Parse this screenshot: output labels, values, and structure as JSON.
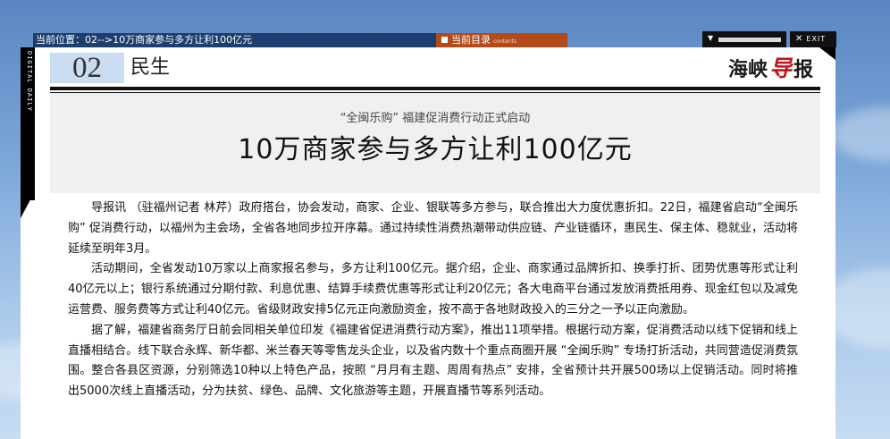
{
  "nav": {
    "location": "当前位置：02-->10万商家参与多方让利100亿元",
    "catalog_label": "当前目录",
    "catalog_sub": "contents",
    "exit_label": "EXIT"
  },
  "spine": {
    "text": "DIGITAL DAILY"
  },
  "header": {
    "page_number": "02",
    "section": "民生",
    "logo_prefix": "海峡",
    "logo_highlight": "导",
    "logo_suffix": "报"
  },
  "article": {
    "kicker": "“全闽乐购” 福建促消费行动正式启动",
    "headline": "10万商家参与多方让利100亿元",
    "paragraphs": [
      "导报讯 （驻福州记者 林芹）政府搭台，协会发动，商家、企业、银联等多方参与，联合推出大力度优惠折扣。22日，福建省启动“全闽乐购” 促消费行动，以福州为主会场，全省各地同步拉开序幕。通过持续性消费热潮带动供应链、产业链循环，惠民生、保主体、稳就业，活动将延续至明年3月。",
      "活动期间，全省发动10万家以上商家报名参与，多方让利100亿元。据介绍，企业、商家通过品牌折扣、换季打折、团势优惠等形式让利40亿元以上；银行系统通过分期付款、利息优惠、结算手续费优惠等形式让利20亿元；各大电商平台通过发放消费抵用券、现金红包以及减免运营费、服务费等方式让利40亿元。省级财政安排5亿元正向激励资金，按不高于各地财政投入的三分之一予以正向激励。",
      "据了解，福建省商务厅日前会同相关单位印发《福建省促进消费行动方案》，推出11项举措。根据行动方案，促消费活动以线下促销和线上直播相结合。线下联合永辉、新华都、米兰春天等零售龙头企业，以及省内数十个重点商圈开展 “全闽乐购” 专场打折活动，共同营造促消费氛围。整合各县区资源，分别筛选10种以上特色产品，按照 “月月有主题、周周有热点” 安排，全省预计共开展500场以上促销活动。同时将推出5000次线上直播活动，分为扶贫、绿色、品牌、文化旅游等主题，开展直播节等系列活动。"
    ]
  },
  "colors": {
    "nav_bg": "#1d3f6e",
    "catalog_bg": "#b24a1a",
    "page_num_bg": "#c9dcf0",
    "logo_accent": "#c0131b"
  }
}
